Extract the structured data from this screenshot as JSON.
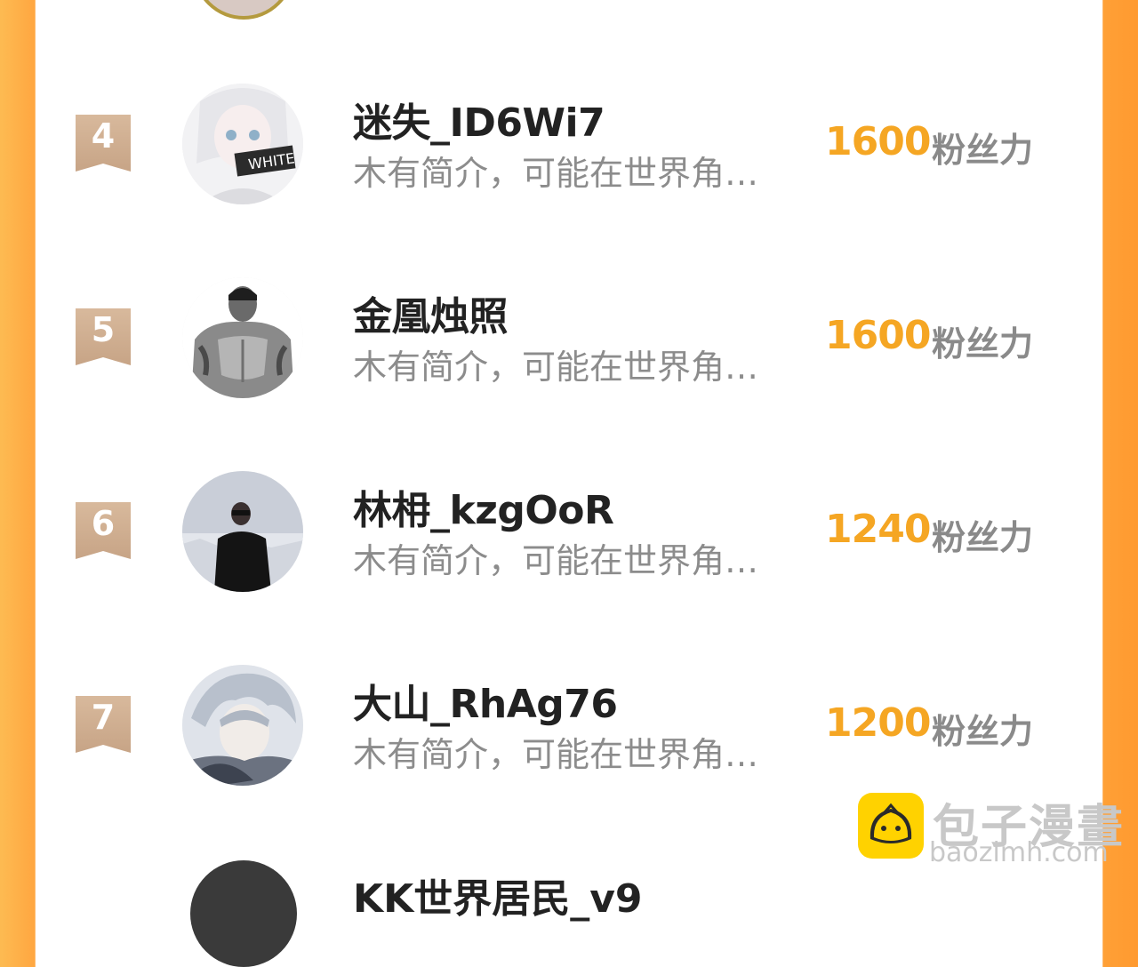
{
  "rows": [
    {
      "rank": "4",
      "name": "迷失_ID6Wi7",
      "bio": "木有简介，可能在世界角…",
      "score": "1600",
      "unit": "粉丝力",
      "avatar_icon": "anime-girl-white-avatar"
    },
    {
      "rank": "5",
      "name": "金凰烛照",
      "bio": "木有简介，可能在世界角…",
      "score": "1600",
      "unit": "粉丝力",
      "avatar_icon": "muscular-man-avatar"
    },
    {
      "rank": "6",
      "name": "林枏_kzgOoR",
      "bio": "木有简介，可能在世界角…",
      "score": "1240",
      "unit": "粉丝力",
      "avatar_icon": "person-in-snow-avatar"
    },
    {
      "rank": "7",
      "name": "大山_RhAg76",
      "bio": "木有简介，可能在世界角…",
      "score": "1200",
      "unit": "粉丝力",
      "avatar_icon": "anime-boy-avatar"
    }
  ],
  "partial_last": {
    "name": "KK世界居民_v9"
  },
  "watermark": {
    "title": "包子漫畫",
    "url": "baozimh.com",
    "icon": "bun-mascot-icon"
  },
  "colors": {
    "accent": "#f5a623",
    "rank_badge": "#d2b295",
    "frame": "#ffa238"
  }
}
